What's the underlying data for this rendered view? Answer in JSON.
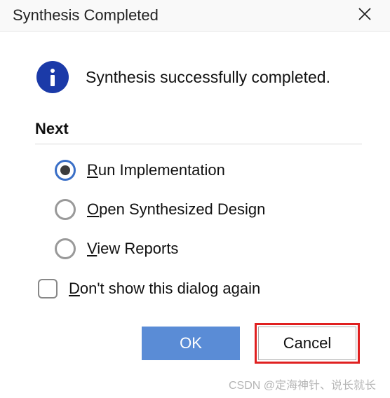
{
  "titlebar": {
    "title": "Synthesis Completed"
  },
  "status": {
    "message": "Synthesis successfully completed."
  },
  "section": {
    "heading": "Next"
  },
  "options": [
    {
      "mnemonic": "R",
      "rest": "un Implementation",
      "selected": true
    },
    {
      "mnemonic": "O",
      "rest": "pen Synthesized Design",
      "selected": false
    },
    {
      "mnemonic": "V",
      "rest": "iew Reports",
      "selected": false
    }
  ],
  "checkbox": {
    "mnemonic": "D",
    "rest": "on't show this dialog again",
    "checked": false
  },
  "buttons": {
    "ok": "OK",
    "cancel": "Cancel"
  },
  "watermark": "CSDN @定海神针、说长就长"
}
